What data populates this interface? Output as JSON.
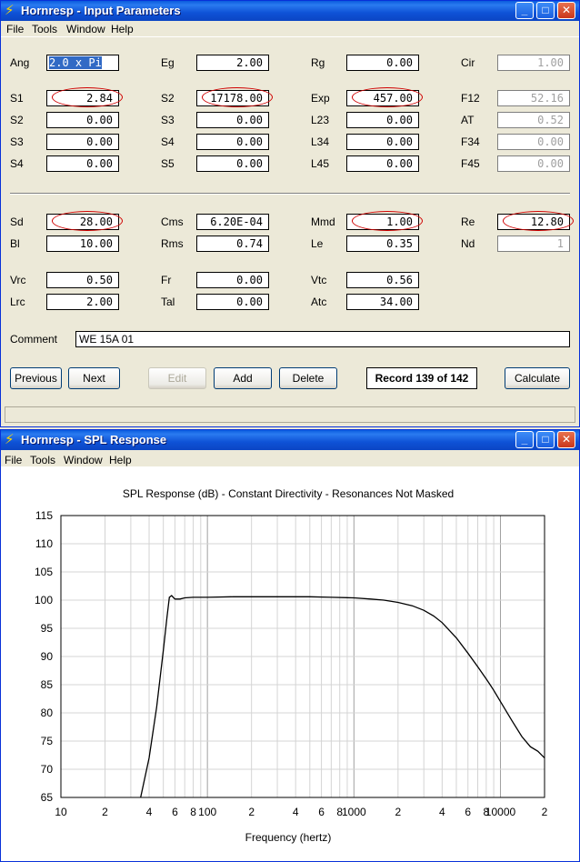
{
  "input_window": {
    "title": "Hornresp - Input Parameters",
    "menu": [
      "File",
      "Tools",
      "Window",
      "Help"
    ],
    "params_top": [
      {
        "label": "Ang",
        "value": "2.0 x Pi",
        "selected": true
      },
      {
        "label": "Eg",
        "value": "2.00"
      },
      {
        "label": "Rg",
        "value": "0.00"
      },
      {
        "label": "Cir",
        "value": "1.00",
        "disabled": true
      },
      {
        "label": "S1",
        "value": "2.84",
        "circled": true
      },
      {
        "label": "S2",
        "value": "17178.00",
        "circled": true
      },
      {
        "label": "Exp",
        "value": "457.00",
        "circled": true
      },
      {
        "label": "F12",
        "value": "52.16",
        "disabled": true
      },
      {
        "label": "S2",
        "value": "0.00"
      },
      {
        "label": "S3",
        "value": "0.00"
      },
      {
        "label": "L23",
        "value": "0.00"
      },
      {
        "label": "AT",
        "value": "0.52",
        "disabled": true
      },
      {
        "label": "S3",
        "value": "0.00"
      },
      {
        "label": "S4",
        "value": "0.00"
      },
      {
        "label": "L34",
        "value": "0.00"
      },
      {
        "label": "F34",
        "value": "0.00",
        "disabled": true
      },
      {
        "label": "S4",
        "value": "0.00"
      },
      {
        "label": "S5",
        "value": "0.00"
      },
      {
        "label": "L45",
        "value": "0.00"
      },
      {
        "label": "F45",
        "value": "0.00",
        "disabled": true
      }
    ],
    "params_bottom": [
      {
        "label": "Sd",
        "value": "28.00",
        "circled": true
      },
      {
        "label": "Cms",
        "value": "6.20E-04"
      },
      {
        "label": "Mmd",
        "value": "1.00",
        "circled": true
      },
      {
        "label": "Re",
        "value": "12.80",
        "circled": true
      },
      {
        "label": "Bl",
        "value": "10.00"
      },
      {
        "label": "Rms",
        "value": "0.74"
      },
      {
        "label": "Le",
        "value": "0.35"
      },
      {
        "label": "Nd",
        "value": "1",
        "disabled": true
      },
      {
        "label": "Vrc",
        "value": "0.50"
      },
      {
        "label": "Fr",
        "value": "0.00"
      },
      {
        "label": "Vtc",
        "value": "0.56"
      },
      {
        "label": "Lrc",
        "value": "2.00"
      },
      {
        "label": "Tal",
        "value": "0.00"
      },
      {
        "label": "Atc",
        "value": "34.00"
      }
    ],
    "comment_label": "Comment",
    "comment_value": "WE 15A 01",
    "buttons": {
      "previous": "Previous",
      "next": "Next",
      "edit": "Edit",
      "add": "Add",
      "delete": "Delete",
      "calculate": "Calculate"
    },
    "record": "Record 139 of 142"
  },
  "spl_window": {
    "title": "Hornresp - SPL Response",
    "menu": [
      "File",
      "Tools",
      "Window",
      "Help"
    ]
  },
  "chart_data": {
    "type": "line",
    "title": "SPL Response (dB) - Constant Directivity - Resonances Not Masked",
    "xlabel": "Frequency (hertz)",
    "ylabel": "",
    "x_scale": "log",
    "xlim": [
      10,
      20000
    ],
    "ylim": [
      65,
      115
    ],
    "y_ticks": [
      115,
      110,
      105,
      100,
      95,
      90,
      85,
      80,
      75,
      70,
      65
    ],
    "x_tick_labels": [
      {
        "x": 10,
        "label": "10"
      },
      {
        "x": 20,
        "label": "2"
      },
      {
        "x": 40,
        "label": "4"
      },
      {
        "x": 60,
        "label": "6"
      },
      {
        "x": 80,
        "label": "8"
      },
      {
        "x": 100,
        "label": "100"
      },
      {
        "x": 200,
        "label": "2"
      },
      {
        "x": 400,
        "label": "4"
      },
      {
        "x": 600,
        "label": "6"
      },
      {
        "x": 800,
        "label": "8"
      },
      {
        "x": 1000,
        "label": "1000"
      },
      {
        "x": 2000,
        "label": "2"
      },
      {
        "x": 4000,
        "label": "4"
      },
      {
        "x": 6000,
        "label": "6"
      },
      {
        "x": 8000,
        "label": "8"
      },
      {
        "x": 10000,
        "label": "10000"
      },
      {
        "x": 20000,
        "label": "2"
      }
    ],
    "grid": true,
    "series": [
      {
        "x": [
          35,
          40,
          45,
          50,
          53,
          55,
          57,
          60,
          65,
          70,
          80,
          100,
          150,
          200,
          300,
          500,
          700,
          1000,
          1300,
          1600,
          2000,
          2500,
          3000,
          3500,
          4000,
          5000,
          6000,
          7000,
          8000,
          8500,
          9000,
          10000,
          12000,
          14000,
          16000,
          18000,
          20000
        ],
        "y": [
          65,
          72,
          81,
          91,
          97,
          100.5,
          100.8,
          100.2,
          100.2,
          100.4,
          100.5,
          100.5,
          100.6,
          100.6,
          100.6,
          100.6,
          100.5,
          100.4,
          100.2,
          100,
          99.6,
          99,
          98.2,
          97.2,
          96,
          93.3,
          90.6,
          88.2,
          86,
          85,
          84,
          82,
          78.6,
          75.8,
          74,
          73.2,
          72
        ]
      }
    ]
  }
}
